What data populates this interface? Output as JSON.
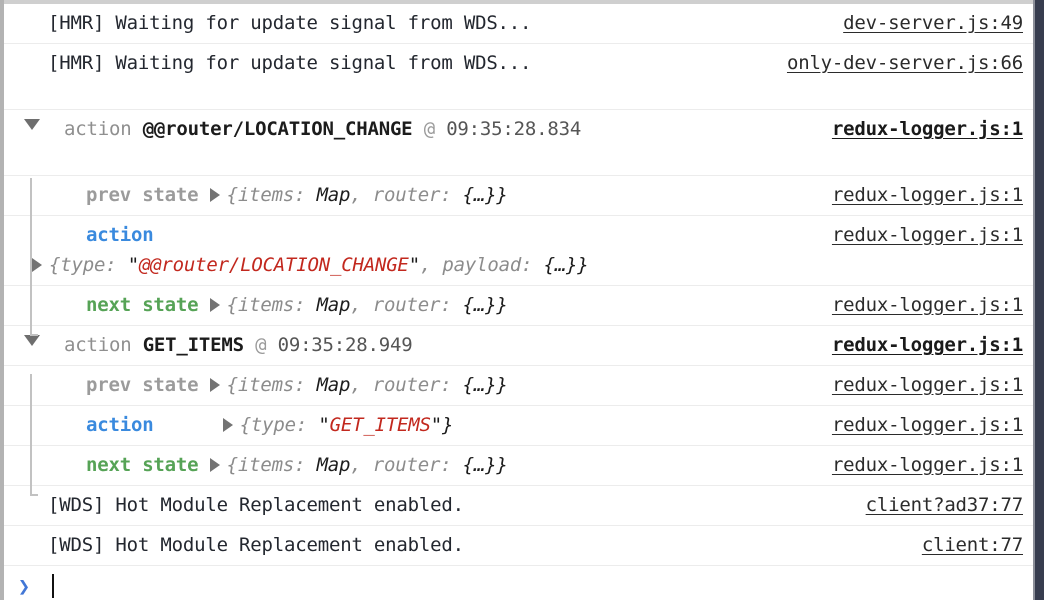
{
  "console": {
    "rows": [
      {
        "kind": "log",
        "message": "[HMR] Waiting for update signal from WDS...",
        "source": "dev-server.js:49"
      },
      {
        "kind": "log",
        "message": "[HMR] Waiting for update signal from WDS...",
        "source": "only-dev-server.js:66"
      },
      {
        "kind": "group-header",
        "label": "action",
        "action_type": "@@router/LOCATION_CHANGE",
        "at": "@",
        "timestamp": "09:35:28.834",
        "source": "redux-logger.js:1"
      },
      {
        "kind": "state",
        "label": "prev state",
        "label_color": "gray",
        "object": "{items: Map, router: {…}}",
        "source": "redux-logger.js:1"
      },
      {
        "kind": "action-wrapped",
        "label": "action",
        "label_color": "blue",
        "object": "{type: \"@@router/LOCATION_CHANGE\", payload: {…}}",
        "object_prefix": "{type: ",
        "object_string": "\"@@router/LOCATION_CHANGE\"",
        "object_suffix": ", payload: {…}}",
        "source": "redux-logger.js:1"
      },
      {
        "kind": "state",
        "label": "next state",
        "label_color": "green",
        "object": "{items: Map, router: {…}}",
        "source": "redux-logger.js:1"
      },
      {
        "kind": "group-header",
        "label": "action",
        "action_type": "GET_ITEMS",
        "at": "@",
        "timestamp": "09:35:28.949",
        "source": "redux-logger.js:1"
      },
      {
        "kind": "state",
        "label": "prev state",
        "label_color": "gray",
        "object": "{items: Map, router: {…}}",
        "source": "redux-logger.js:1"
      },
      {
        "kind": "action-inline",
        "label": "action",
        "label_color": "blue",
        "object_prefix": "{type: ",
        "object_string": "\"GET_ITEMS\"",
        "object_suffix": "}",
        "source": "redux-logger.js:1"
      },
      {
        "kind": "state",
        "label": "next state",
        "label_color": "green",
        "object": "{items: Map, router: {…}}",
        "source": "redux-logger.js:1"
      },
      {
        "kind": "log",
        "message": "[WDS] Hot Module Replacement enabled.",
        "source": "client?ad37:77"
      },
      {
        "kind": "log",
        "message": "[WDS] Hot Module Replacement enabled.",
        "source": "client:77"
      }
    ],
    "prompt": {
      "chevron": "❯",
      "value": ""
    },
    "colors": {
      "action_label": "#3a8ade",
      "next_state_label": "#56a356",
      "prev_state_label": "#9b9b9b",
      "string_value": "#c2281e",
      "prompt_chevron": "#4277d6",
      "right_panel": "#373d4f"
    }
  }
}
